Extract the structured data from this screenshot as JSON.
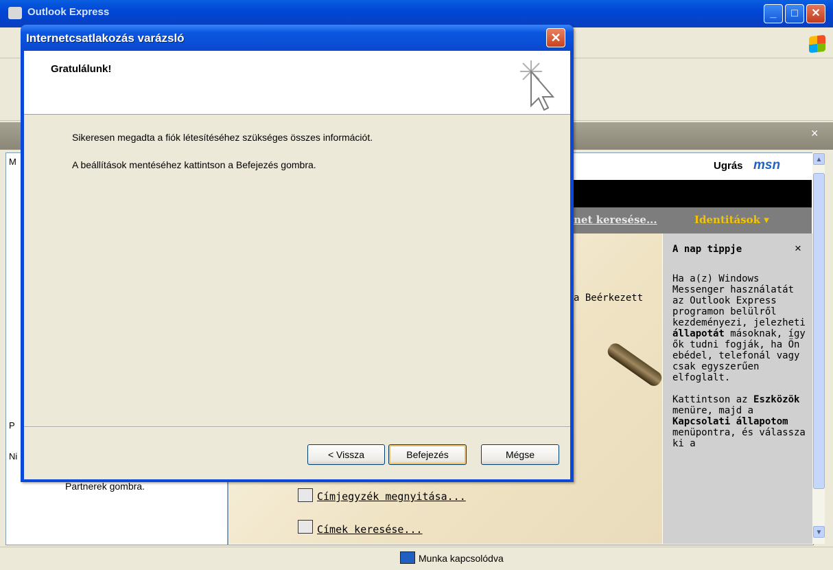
{
  "background_window": {
    "title": "Outlook Express",
    "left_panel": {
      "letter_top": "M",
      "letter_contacts": "P",
      "letter_bottom": "Ni",
      "contacts_tip": "Partnerek gombra."
    },
    "msn": {
      "goto_label": "Ugrás",
      "logo": "msn"
    },
    "nav": {
      "search_label": "net keresése...",
      "identities_label": "Identitások ▾"
    },
    "content_fragment": "a Beérkezett",
    "links": [
      {
        "label": "Címjegyzék megnyitása...",
        "icon": "address-book-icon"
      },
      {
        "label": "Címek keresése...",
        "icon": "find-people-icon"
      }
    ],
    "tip": {
      "title": "A nap tippje",
      "close": "×",
      "p1_a": "Ha a(z) Windows Messenger használatát az Outlook Express programon belülről kezdeményezi, jelezheti ",
      "p1_b": "állapotát",
      "p1_c": " másoknak, így ők tudni fogják, ha Ön ebédel, telefonál vagy csak egyszerűen elfoglalt.",
      "p2_a": "Kattintson az ",
      "p2_b": "Eszközök",
      "p2_c": " menüre, majd a ",
      "p2_d": "Kapcsolati állapotom",
      "p2_e": " menüpontra, és válassza ki a"
    },
    "status": {
      "text": "Munka kapcsolódva",
      "icon": "network-computer-icon"
    },
    "header_close": "×"
  },
  "dialog": {
    "title": "Internetcsatlakozás varázsló",
    "close": "✕",
    "heading": "Gratulálunk!",
    "line1": "Sikeresen megadta a fiók létesítéséhez szükséges összes információt.",
    "line2": "A beállítások mentéséhez kattintson a Befejezés gombra.",
    "buttons": {
      "back": "< Vissza",
      "finish": "Befejezés",
      "cancel": "Mégse"
    }
  }
}
